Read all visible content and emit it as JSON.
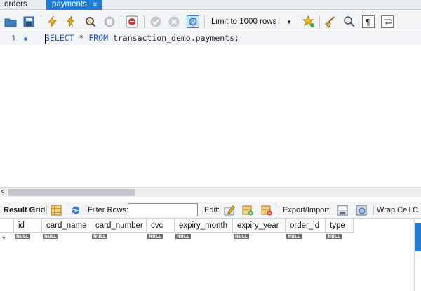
{
  "tabs": [
    {
      "label": "orders",
      "active": false
    },
    {
      "label": "payments",
      "active": true,
      "close_glyph": "×"
    }
  ],
  "query_toolbar": {
    "icons": [
      "open-folder-icon",
      "save-icon",
      "execute-icon",
      "execute-current-icon",
      "explain-icon",
      "stop-icon",
      "toggle-error-icon",
      "commit-icon",
      "rollback-icon",
      "autocommit-icon",
      "add-snippet-icon",
      "beautify-icon",
      "find-icon",
      "invisible-chars-icon",
      "word-wrap-icon"
    ],
    "limit_select": {
      "value": "Limit to 1000 rows"
    }
  },
  "editor": {
    "line_number": "1",
    "code": {
      "select": "SELECT",
      "star": " * ",
      "from": "FROM",
      "rest": " transaction_demo.payments;"
    }
  },
  "scrollbar": {
    "left_arrow": "<"
  },
  "result_toolbar": {
    "result_grid_label": "Result Grid",
    "filter_label": "Filter Rows:",
    "filter_value": "",
    "edit_label": "Edit:",
    "export_label": "Export/Import:",
    "wrap_label": "Wrap Cell C"
  },
  "grid": {
    "columns": [
      "id",
      "card_name",
      "card_number",
      "cvc",
      "expiry_month",
      "expiry_year",
      "order_id",
      "type"
    ],
    "null_label": "NULL",
    "new_row_marker": "*"
  },
  "colors": {
    "accent": "#1f7dd3",
    "keyword": "#1a55c8"
  }
}
